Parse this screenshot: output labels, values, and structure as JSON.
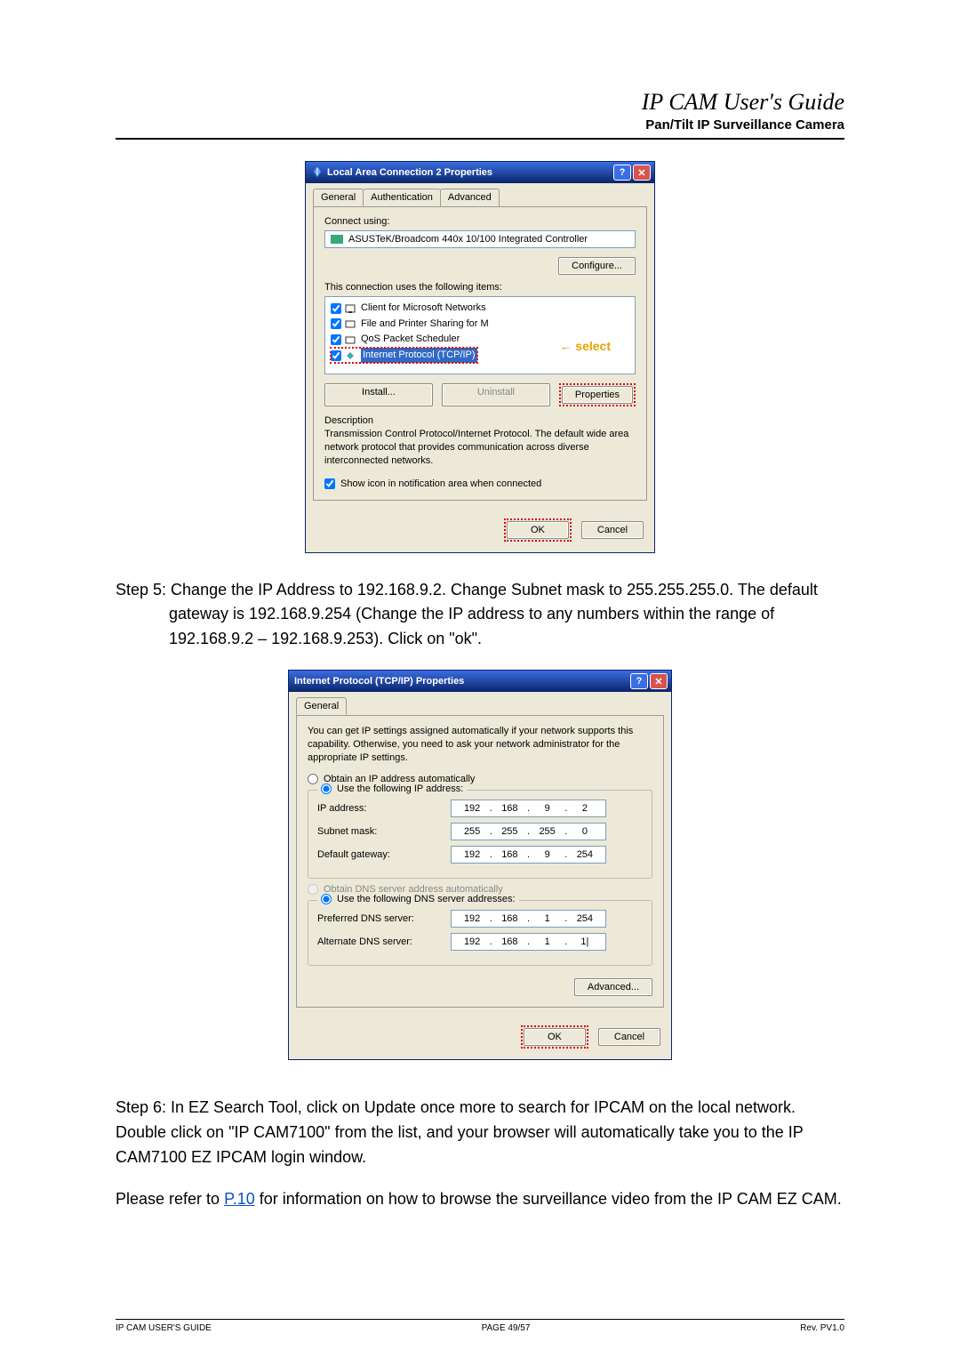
{
  "header": {
    "title": "IP CAM User's Guide",
    "subtitle": "Pan/Tilt IP Surveillance Camera"
  },
  "dlg1": {
    "title": "Local Area Connection 2 Properties",
    "tabs": {
      "general": "General",
      "auth": "Authentication",
      "adv": "Advanced"
    },
    "connect_label": "Connect using:",
    "adapter": "ASUSTeK/Broadcom 440x 10/100 Integrated Controller",
    "configure": "Configure...",
    "items_label": "This connection uses the following items:",
    "items": {
      "a": "Client for Microsoft Networks",
      "b": "File and Printer Sharing for M",
      "c": "QoS Packet Scheduler",
      "d": "Internet Protocol (TCP/IP)"
    },
    "callout": "← select",
    "btns": {
      "install": "Install...",
      "uninstall": "Uninstall",
      "props": "Properties"
    },
    "desc_label": "Description",
    "desc_text": "Transmission Control Protocol/Internet Protocol. The default wide area network protocol that provides communication across diverse interconnected networks.",
    "show_icon": "Show icon in notification area when connected",
    "ok": "OK",
    "cancel": "Cancel"
  },
  "step5": "Step 5: Change the IP Address to 192.168.9.2. Change Subnet mask to 255.255.255.0. The default gateway is 192.168.9.254 (Change the IP address to any numbers within the range of 192.168.9.2 – 192.168.9.253). Click on \"ok\".",
  "dlg2": {
    "title": "Internet Protocol (TCP/IP) Properties",
    "tab": "General",
    "blurb": "You can get IP settings assigned automatically if your network supports this capability. Otherwise, you need to ask your network administrator for the appropriate IP settings.",
    "r1": "Obtain an IP address automatically",
    "r2": "Use the following IP address:",
    "ip_label": "IP address:",
    "ip": {
      "a": "192",
      "b": "168",
      "c": "9",
      "d": "2"
    },
    "mask_label": "Subnet mask:",
    "mask": {
      "a": "255",
      "b": "255",
      "c": "255",
      "d": "0"
    },
    "gw_label": "Default gateway:",
    "gw": {
      "a": "192",
      "b": "168",
      "c": "9",
      "d": "254"
    },
    "r3": "Obtain DNS server address automatically",
    "r4": "Use the following DNS server addresses:",
    "pdns_label": "Preferred DNS server:",
    "pdns": {
      "a": "192",
      "b": "168",
      "c": "1",
      "d": "254"
    },
    "adns_label": "Alternate DNS server:",
    "adns": {
      "a": "192",
      "b": "168",
      "c": "1",
      "d": "1|"
    },
    "adv": "Advanced...",
    "ok": "OK",
    "cancel": "Cancel"
  },
  "step6": "Step 6: In EZ Search Tool, click on Update once more to search for IPCAM on the local network. Double click on \"IP CAM7100\" from the list, and your browser will automatically take you to the IP CAM7100 EZ IPCAM login window.",
  "ref_pre": "Please refer to ",
  "ref_link": "P.10",
  "ref_post": " for information on how to browse the surveillance video from the IP CAM EZ CAM.",
  "footer": {
    "left": "IP CAM USER'S GUIDE",
    "center": "PAGE 49/57",
    "right": "Rev. PV1.0"
  }
}
